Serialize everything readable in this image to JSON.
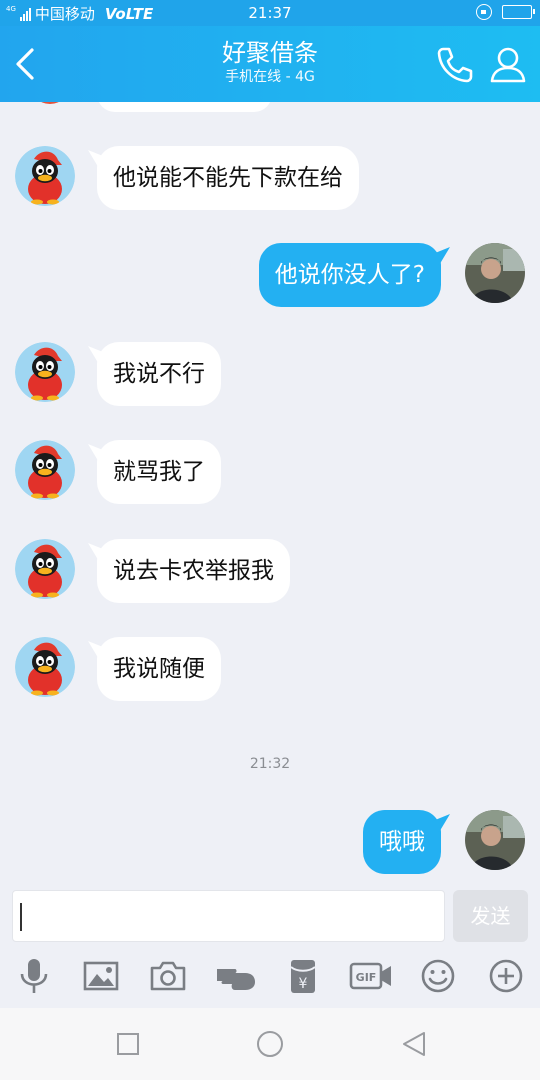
{
  "status_bar": {
    "network_tag": "4G",
    "carrier": "中国移动",
    "volte": "VoLTE",
    "time": "21:37"
  },
  "header": {
    "title": "好聚借条",
    "subtitle": "手机在线 - 4G",
    "back_icon": "chevron-left-icon",
    "call_icon": "phone-icon",
    "profile_icon": "person-icon"
  },
  "messages": [
    {
      "side": "in",
      "text": "他说能不能先下款在给"
    },
    {
      "side": "out",
      "text": "他说你没人了?"
    },
    {
      "side": "in",
      "text": "我说不行"
    },
    {
      "side": "in",
      "text": "就骂我了"
    },
    {
      "side": "in",
      "text": "说去卡农举报我"
    },
    {
      "side": "in",
      "text": "我说随便"
    },
    {
      "side": "out",
      "text": "哦哦"
    }
  ],
  "time_separator": "21:32",
  "composer": {
    "input_value": "",
    "send_label": "发送"
  },
  "toolbar_icons": [
    "microphone-icon",
    "image-icon",
    "camera-icon",
    "poke-hand-icon",
    "red-packet-icon",
    "gif-icon",
    "emoji-icon",
    "plus-icon"
  ],
  "toolbar": {
    "gif_label": "GIF",
    "packet_label": "¥"
  },
  "navigation": [
    "recent-apps-icon",
    "home-icon",
    "back-icon"
  ],
  "colors": {
    "brand": "#20a4ea",
    "outgoing_bubble": "#23b0f2",
    "chat_background": "#eef0f6"
  }
}
